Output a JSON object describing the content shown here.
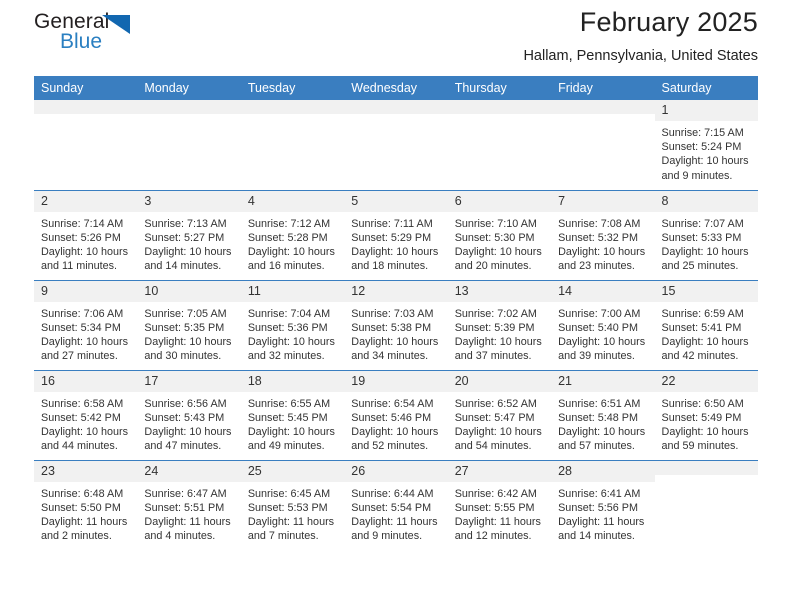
{
  "brand": {
    "name_part1": "General",
    "name_part2": "Blue",
    "accent_color": "#2a7fc1",
    "triangle_icon": "triangle-icon"
  },
  "header": {
    "title": "February 2025",
    "subtitle": "Hallam, Pennsylvania, United States"
  },
  "theme": {
    "header_bg": "#3a7ec0",
    "header_text": "#ffffff",
    "daynum_bg": "#f1f1f1",
    "row_divider": "#3a7ec0"
  },
  "weekday_headers": [
    "Sunday",
    "Monday",
    "Tuesday",
    "Wednesday",
    "Thursday",
    "Friday",
    "Saturday"
  ],
  "labels": {
    "sunrise_prefix": "Sunrise:",
    "sunset_prefix": "Sunset:",
    "daylight_prefix": "Daylight:"
  },
  "weeks": [
    [
      {
        "empty": true
      },
      {
        "empty": true
      },
      {
        "empty": true
      },
      {
        "empty": true
      },
      {
        "empty": true
      },
      {
        "empty": true
      },
      {
        "day": "1",
        "sunrise": "Sunrise: 7:15 AM",
        "sunset": "Sunset: 5:24 PM",
        "daylight_line1": "Daylight: 10 hours",
        "daylight_line2": "and 9 minutes."
      }
    ],
    [
      {
        "day": "2",
        "sunrise": "Sunrise: 7:14 AM",
        "sunset": "Sunset: 5:26 PM",
        "daylight_line1": "Daylight: 10 hours",
        "daylight_line2": "and 11 minutes."
      },
      {
        "day": "3",
        "sunrise": "Sunrise: 7:13 AM",
        "sunset": "Sunset: 5:27 PM",
        "daylight_line1": "Daylight: 10 hours",
        "daylight_line2": "and 14 minutes."
      },
      {
        "day": "4",
        "sunrise": "Sunrise: 7:12 AM",
        "sunset": "Sunset: 5:28 PM",
        "daylight_line1": "Daylight: 10 hours",
        "daylight_line2": "and 16 minutes."
      },
      {
        "day": "5",
        "sunrise": "Sunrise: 7:11 AM",
        "sunset": "Sunset: 5:29 PM",
        "daylight_line1": "Daylight: 10 hours",
        "daylight_line2": "and 18 minutes."
      },
      {
        "day": "6",
        "sunrise": "Sunrise: 7:10 AM",
        "sunset": "Sunset: 5:30 PM",
        "daylight_line1": "Daylight: 10 hours",
        "daylight_line2": "and 20 minutes."
      },
      {
        "day": "7",
        "sunrise": "Sunrise: 7:08 AM",
        "sunset": "Sunset: 5:32 PM",
        "daylight_line1": "Daylight: 10 hours",
        "daylight_line2": "and 23 minutes."
      },
      {
        "day": "8",
        "sunrise": "Sunrise: 7:07 AM",
        "sunset": "Sunset: 5:33 PM",
        "daylight_line1": "Daylight: 10 hours",
        "daylight_line2": "and 25 minutes."
      }
    ],
    [
      {
        "day": "9",
        "sunrise": "Sunrise: 7:06 AM",
        "sunset": "Sunset: 5:34 PM",
        "daylight_line1": "Daylight: 10 hours",
        "daylight_line2": "and 27 minutes."
      },
      {
        "day": "10",
        "sunrise": "Sunrise: 7:05 AM",
        "sunset": "Sunset: 5:35 PM",
        "daylight_line1": "Daylight: 10 hours",
        "daylight_line2": "and 30 minutes."
      },
      {
        "day": "11",
        "sunrise": "Sunrise: 7:04 AM",
        "sunset": "Sunset: 5:36 PM",
        "daylight_line1": "Daylight: 10 hours",
        "daylight_line2": "and 32 minutes."
      },
      {
        "day": "12",
        "sunrise": "Sunrise: 7:03 AM",
        "sunset": "Sunset: 5:38 PM",
        "daylight_line1": "Daylight: 10 hours",
        "daylight_line2": "and 34 minutes."
      },
      {
        "day": "13",
        "sunrise": "Sunrise: 7:02 AM",
        "sunset": "Sunset: 5:39 PM",
        "daylight_line1": "Daylight: 10 hours",
        "daylight_line2": "and 37 minutes."
      },
      {
        "day": "14",
        "sunrise": "Sunrise: 7:00 AM",
        "sunset": "Sunset: 5:40 PM",
        "daylight_line1": "Daylight: 10 hours",
        "daylight_line2": "and 39 minutes."
      },
      {
        "day": "15",
        "sunrise": "Sunrise: 6:59 AM",
        "sunset": "Sunset: 5:41 PM",
        "daylight_line1": "Daylight: 10 hours",
        "daylight_line2": "and 42 minutes."
      }
    ],
    [
      {
        "day": "16",
        "sunrise": "Sunrise: 6:58 AM",
        "sunset": "Sunset: 5:42 PM",
        "daylight_line1": "Daylight: 10 hours",
        "daylight_line2": "and 44 minutes."
      },
      {
        "day": "17",
        "sunrise": "Sunrise: 6:56 AM",
        "sunset": "Sunset: 5:43 PM",
        "daylight_line1": "Daylight: 10 hours",
        "daylight_line2": "and 47 minutes."
      },
      {
        "day": "18",
        "sunrise": "Sunrise: 6:55 AM",
        "sunset": "Sunset: 5:45 PM",
        "daylight_line1": "Daylight: 10 hours",
        "daylight_line2": "and 49 minutes."
      },
      {
        "day": "19",
        "sunrise": "Sunrise: 6:54 AM",
        "sunset": "Sunset: 5:46 PM",
        "daylight_line1": "Daylight: 10 hours",
        "daylight_line2": "and 52 minutes."
      },
      {
        "day": "20",
        "sunrise": "Sunrise: 6:52 AM",
        "sunset": "Sunset: 5:47 PM",
        "daylight_line1": "Daylight: 10 hours",
        "daylight_line2": "and 54 minutes."
      },
      {
        "day": "21",
        "sunrise": "Sunrise: 6:51 AM",
        "sunset": "Sunset: 5:48 PM",
        "daylight_line1": "Daylight: 10 hours",
        "daylight_line2": "and 57 minutes."
      },
      {
        "day": "22",
        "sunrise": "Sunrise: 6:50 AM",
        "sunset": "Sunset: 5:49 PM",
        "daylight_line1": "Daylight: 10 hours",
        "daylight_line2": "and 59 minutes."
      }
    ],
    [
      {
        "day": "23",
        "sunrise": "Sunrise: 6:48 AM",
        "sunset": "Sunset: 5:50 PM",
        "daylight_line1": "Daylight: 11 hours",
        "daylight_line2": "and 2 minutes."
      },
      {
        "day": "24",
        "sunrise": "Sunrise: 6:47 AM",
        "sunset": "Sunset: 5:51 PM",
        "daylight_line1": "Daylight: 11 hours",
        "daylight_line2": "and 4 minutes."
      },
      {
        "day": "25",
        "sunrise": "Sunrise: 6:45 AM",
        "sunset": "Sunset: 5:53 PM",
        "daylight_line1": "Daylight: 11 hours",
        "daylight_line2": "and 7 minutes."
      },
      {
        "day": "26",
        "sunrise": "Sunrise: 6:44 AM",
        "sunset": "Sunset: 5:54 PM",
        "daylight_line1": "Daylight: 11 hours",
        "daylight_line2": "and 9 minutes."
      },
      {
        "day": "27",
        "sunrise": "Sunrise: 6:42 AM",
        "sunset": "Sunset: 5:55 PM",
        "daylight_line1": "Daylight: 11 hours",
        "daylight_line2": "and 12 minutes."
      },
      {
        "day": "28",
        "sunrise": "Sunrise: 6:41 AM",
        "sunset": "Sunset: 5:56 PM",
        "daylight_line1": "Daylight: 11 hours",
        "daylight_line2": "and 14 minutes."
      },
      {
        "empty": true
      }
    ]
  ]
}
